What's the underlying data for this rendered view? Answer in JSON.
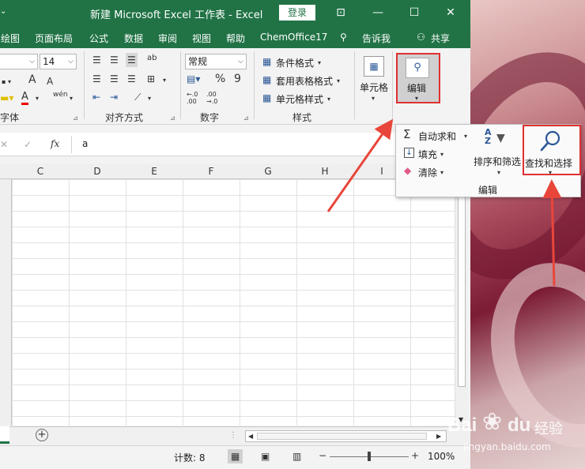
{
  "window": {
    "title": "新建 Microsoft Excel 工作表  -  Excel",
    "login_label": "登录",
    "controls": {
      "ribbon_display": "⊡",
      "minimize": "—",
      "maximize": "☐",
      "close": "✕"
    }
  },
  "menu": {
    "items": [
      "绘图",
      "页面布局",
      "公式",
      "数据",
      "审阅",
      "视图",
      "帮助",
      "ChemOffice17"
    ],
    "tell_me": "告诉我",
    "share": "共享"
  },
  "ribbon": {
    "font": {
      "font_size": "14",
      "group_label": "字体",
      "grow_font": "A",
      "shrink_font": "A",
      "font_color": "A",
      "phonetic": "wén"
    },
    "alignment": {
      "orientation": "ab",
      "group_label": "对齐方式"
    },
    "number": {
      "format": "常规",
      "percent": "%",
      "comma": "9",
      "increase_decimal": "←.0 .00",
      "decrease_decimal": ".00 →.0",
      "group_label": "数字"
    },
    "styles": {
      "conditional": "条件格式",
      "table": "套用表格格式",
      "cell": "单元格样式",
      "group_label": "样式"
    },
    "cells": {
      "label": "单元格"
    },
    "editing": {
      "label": "编辑"
    }
  },
  "formula_bar": {
    "cancel": "✕",
    "enter": "✓",
    "fx": "fx",
    "value": "a"
  },
  "columns": [
    "C",
    "D",
    "E",
    "F",
    "G",
    "H",
    "I"
  ],
  "edit_panel": {
    "autosum": "自动求和",
    "fill": "填充",
    "clear": "清除",
    "sort_filter": "排序和筛选",
    "find_select": "查找和选择",
    "group_label": "编辑"
  },
  "sheet_bar": {
    "add_sheet": "+"
  },
  "status": {
    "count": "计数: 8",
    "zoom": "100%",
    "zoom_level": 100
  },
  "watermark": {
    "brand": "Bai",
    "paw": "du",
    "jingyan": "经验",
    "url": "jingyan.baidu.com"
  },
  "colors": {
    "excel_green": "#217346",
    "highlight_red": "#e03030",
    "arrow_red": "#e8463a"
  }
}
